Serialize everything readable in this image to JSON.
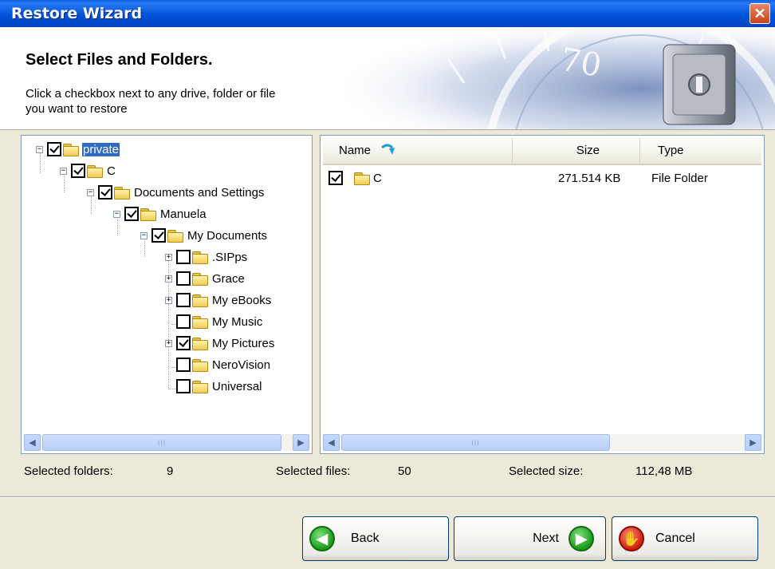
{
  "window": {
    "title": "Restore Wizard",
    "close_symbol": "✕"
  },
  "header": {
    "title": "Select Files and Folders.",
    "subtitle_line1": "Click a checkbox next to any drive, folder or file",
    "subtitle_line2": "you want to restore",
    "art_text": "70"
  },
  "tree": {
    "items": [
      {
        "label": "private",
        "checked": true,
        "expander": "minus"
      },
      {
        "label": "C",
        "checked": true,
        "expander": "minus"
      },
      {
        "label": "Documents and Settings",
        "checked": true,
        "expander": "minus"
      },
      {
        "label": "Manuela",
        "checked": true,
        "expander": "minus"
      },
      {
        "label": "My Documents",
        "checked": true,
        "expander": "minus"
      },
      {
        "label": ".SIPps",
        "checked": false,
        "expander": "plus"
      },
      {
        "label": "Grace",
        "checked": false,
        "expander": "plus"
      },
      {
        "label": "My eBooks",
        "checked": false,
        "expander": "plus"
      },
      {
        "label": "My Music",
        "checked": false,
        "expander": "none"
      },
      {
        "label": "My Pictures",
        "checked": true,
        "expander": "plus"
      },
      {
        "label": "NeroVision",
        "checked": false,
        "expander": "none"
      },
      {
        "label": "Universal",
        "checked": false,
        "expander": "none"
      }
    ]
  },
  "list": {
    "columns": {
      "name": "Name",
      "size": "Size",
      "type": "Type"
    },
    "rows": [
      {
        "name": "C",
        "size": "271.514 KB",
        "type": "File Folder",
        "checked": true
      }
    ]
  },
  "scrollbar": {
    "grip": "III",
    "left_arrow": "◀",
    "right_arrow": "▶"
  },
  "status": {
    "folders_label": "Selected folders:",
    "folders_value": "9",
    "files_label": "Selected files:",
    "files_value": "50",
    "size_label": "Selected size:",
    "size_value": "112,48 MB"
  },
  "buttons": {
    "back": "Back",
    "next": "Next",
    "cancel": "Cancel"
  },
  "colors": {
    "titlebar": "#0053d9",
    "selection": "#316ac5",
    "folder": "#f0cc57"
  }
}
